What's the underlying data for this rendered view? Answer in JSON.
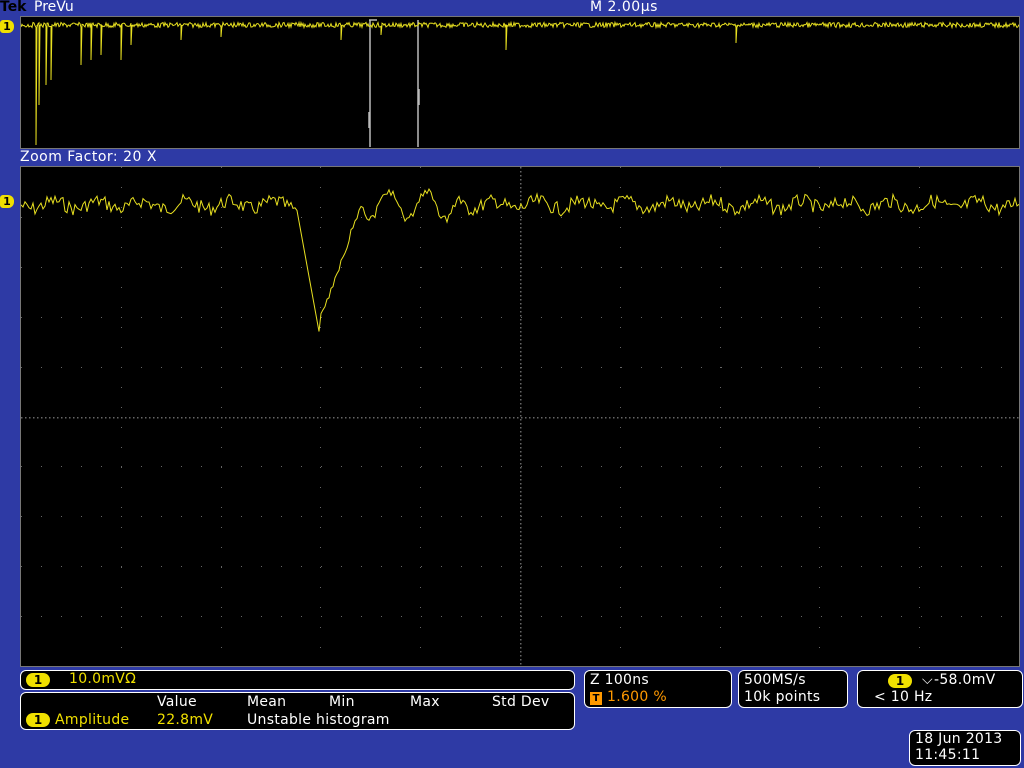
{
  "header": {
    "logo": "Tek",
    "mode": "PreVu",
    "timebase": "M 2.00µs"
  },
  "channel": {
    "number": "1",
    "color": "#f0e000"
  },
  "trigger_marker": "T",
  "zoom": {
    "label": "Zoom Factor: 20 X"
  },
  "vertical": {
    "scale": "10.0mVΩ"
  },
  "measurements": {
    "headers": [
      "Value",
      "Mean",
      "Min",
      "Max",
      "Std Dev"
    ],
    "row_label": "Amplitude",
    "value": "22.8mV",
    "status": "Unstable histogram"
  },
  "zoom_settings": {
    "scale": "Z 100ns",
    "position": "1.600 %"
  },
  "acquisition": {
    "rate": "500MS/s",
    "record": "10k points"
  },
  "trigger": {
    "level": "-58.0mV",
    "frequency": "< 10 Hz"
  },
  "datetime": {
    "date": "18 Jun  2013",
    "time": "11:45:11"
  },
  "colors": {
    "background": "#2e3aa5",
    "trace": "#e8e020",
    "trigger": "#ff9900",
    "screen": "#000000"
  }
}
